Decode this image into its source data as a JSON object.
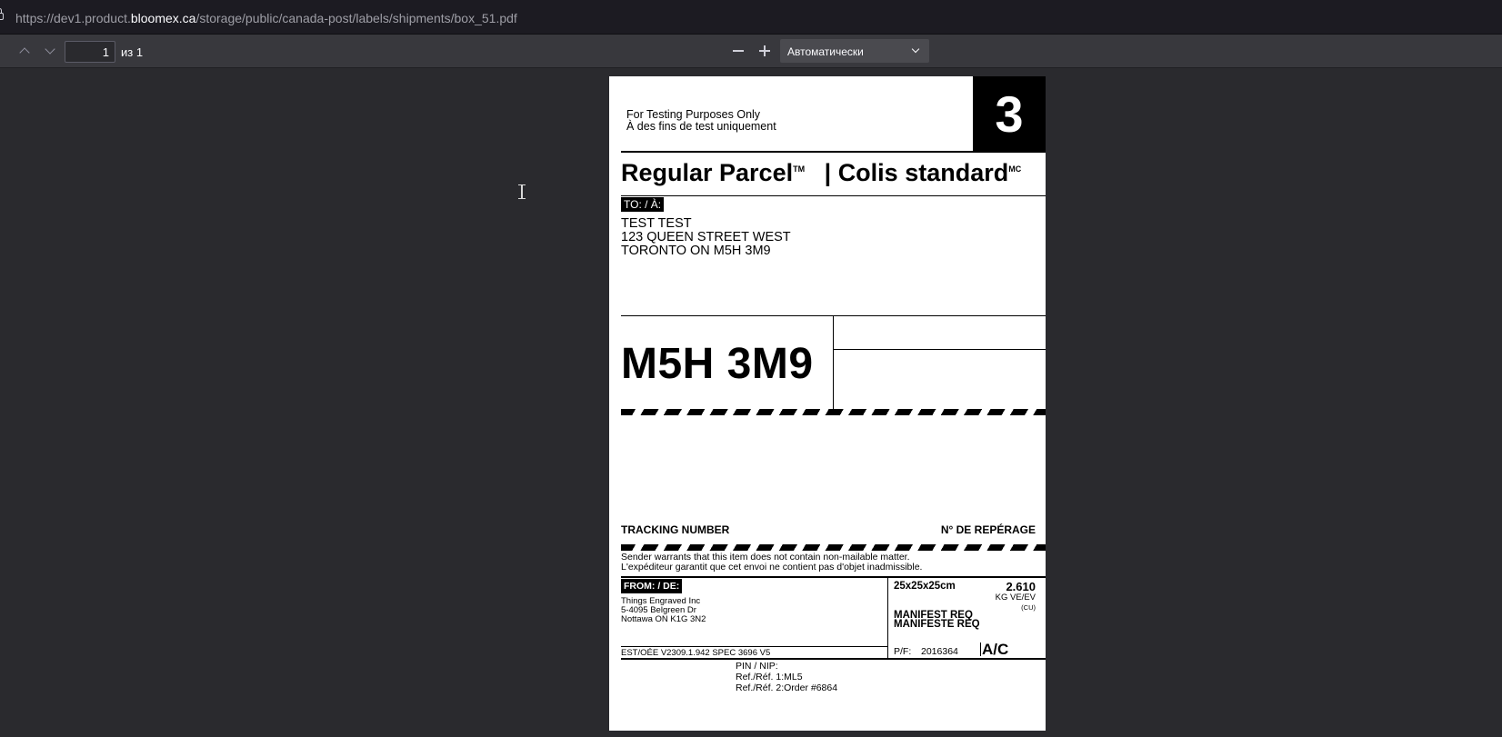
{
  "browser": {
    "url_prefix": "https://dev1.product.",
    "url_host": "bloomex.ca",
    "url_path": "/storage/public/canada-post/labels/shipments/box_51.pdf"
  },
  "pdf_toolbar": {
    "page_number": "1",
    "page_of": "из 1",
    "zoom_value": "Автоматически"
  },
  "label": {
    "test_en": "For Testing Purposes Only",
    "test_fr": "À des fins de test uniquement",
    "zone": "3",
    "service_en": "Regular Parcel",
    "service_en_mark": "TM",
    "service_sep": "|",
    "service_fr": "Colis standard",
    "service_fr_mark": "MC",
    "to_label": "TO: / À:",
    "to_lines": [
      "TEST TEST",
      "123 QUEEN STREET WEST",
      "TORONTO ON  M5H 3M9"
    ],
    "postal_code": "M5H 3M9",
    "tracking_en": "TRACKING NUMBER",
    "tracking_fr": "N° DE REPÉRAGE",
    "warrant_en": "Sender warrants that this item does not contain non-mailable matter.",
    "warrant_fr": "L'expéditeur garantit que cet envoi ne contient pas d'objet inadmissible.",
    "from_label": "FROM: / DE:",
    "from_lines": [
      "Things Engraved Inc",
      "5-4095 Belgreen Dr",
      "Nottawa ON  K1G 3N2"
    ],
    "est_line": "EST/OÉE V2309.1.942   SPEC 3696 V5",
    "dimensions": "25x25x25cm",
    "weight": "2.610",
    "weight_unit": "KG VE/EV",
    "cu": "(CU)",
    "manifest_en": "MANIFEST REQ",
    "manifest_fr": "MANIFESTE REQ",
    "pf_label": "P/F:",
    "pf_value": "2016364",
    "ac": "A/C",
    "pin": "PIN / NIP:",
    "ref1_label": "Ref./Réf. 1:",
    "ref1_value": "ML5",
    "ref2_label": "Ref./Réf. 2:",
    "ref2_value": "Order #6864"
  }
}
